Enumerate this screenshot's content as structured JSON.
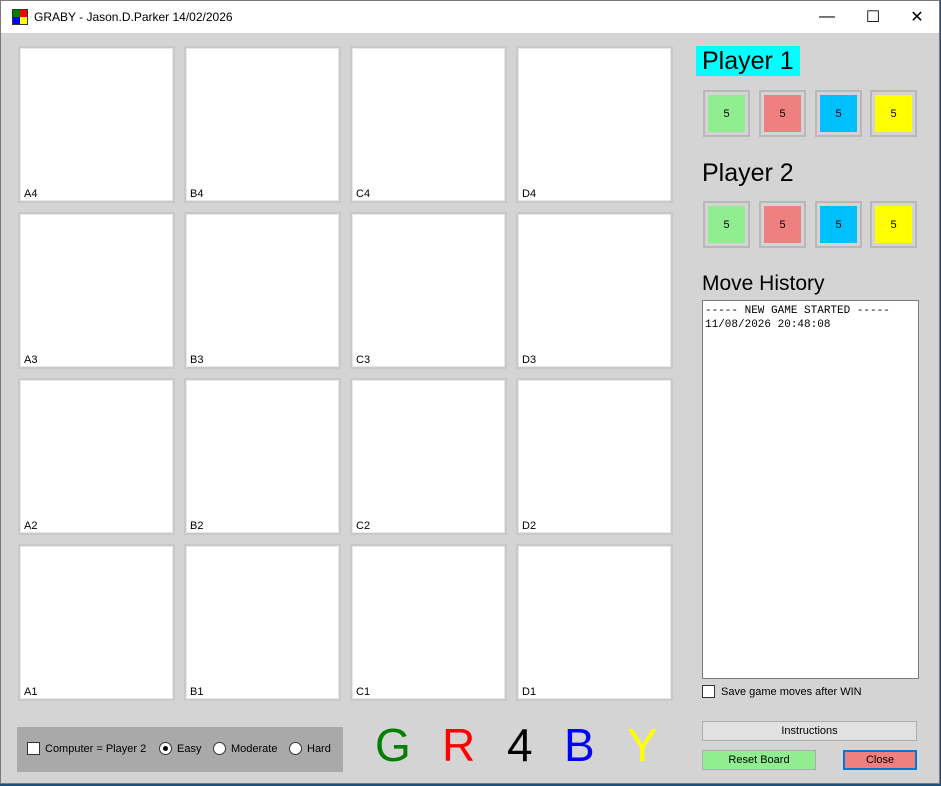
{
  "window": {
    "title": "GRABY - Jason.D.Parker 14/02/2026",
    "minimize": "—",
    "maximize": "☐",
    "close": "✕"
  },
  "board": {
    "rows": [
      [
        "A4",
        "B4",
        "C4",
        "D4"
      ],
      [
        "A3",
        "B3",
        "C3",
        "D3"
      ],
      [
        "A2",
        "B2",
        "C2",
        "D2"
      ],
      [
        "A1",
        "B1",
        "C1",
        "D1"
      ]
    ]
  },
  "player1": {
    "title": "Player 1",
    "counters": [
      {
        "value": "5",
        "color": "#90ee90"
      },
      {
        "value": "5",
        "color": "#f08080"
      },
      {
        "value": "5",
        "color": "#00bfff"
      },
      {
        "value": "5",
        "color": "#ffff00"
      }
    ]
  },
  "player2": {
    "title": "Player 2",
    "counters": [
      {
        "value": "5",
        "color": "#90ee90"
      },
      {
        "value": "5",
        "color": "#f08080"
      },
      {
        "value": "5",
        "color": "#00bfff"
      },
      {
        "value": "5",
        "color": "#ffff00"
      }
    ]
  },
  "history": {
    "title": "Move History",
    "lines": [
      "----- NEW GAME STARTED -----",
      "11/08/2026 20:48:08"
    ]
  },
  "save_option": {
    "label": "Save game moves after WIN",
    "checked": false
  },
  "options": {
    "computer_label": "Computer = Player 2",
    "computer_checked": false,
    "difficulty": [
      {
        "label": "Easy",
        "selected": true
      },
      {
        "label": "Moderate",
        "selected": false
      },
      {
        "label": "Hard",
        "selected": false
      }
    ]
  },
  "logo": [
    {
      "letter": "G",
      "color": "#008000"
    },
    {
      "letter": "R",
      "color": "#ff0000"
    },
    {
      "letter": "4",
      "color": "#000000"
    },
    {
      "letter": "B",
      "color": "#0000ff"
    },
    {
      "letter": "Y",
      "color": "#ffff00"
    }
  ],
  "buttons": {
    "instructions": "Instructions",
    "reset": "Reset Board",
    "close": "Close",
    "reset_color": "#90ee90",
    "close_color": "#f08080"
  }
}
